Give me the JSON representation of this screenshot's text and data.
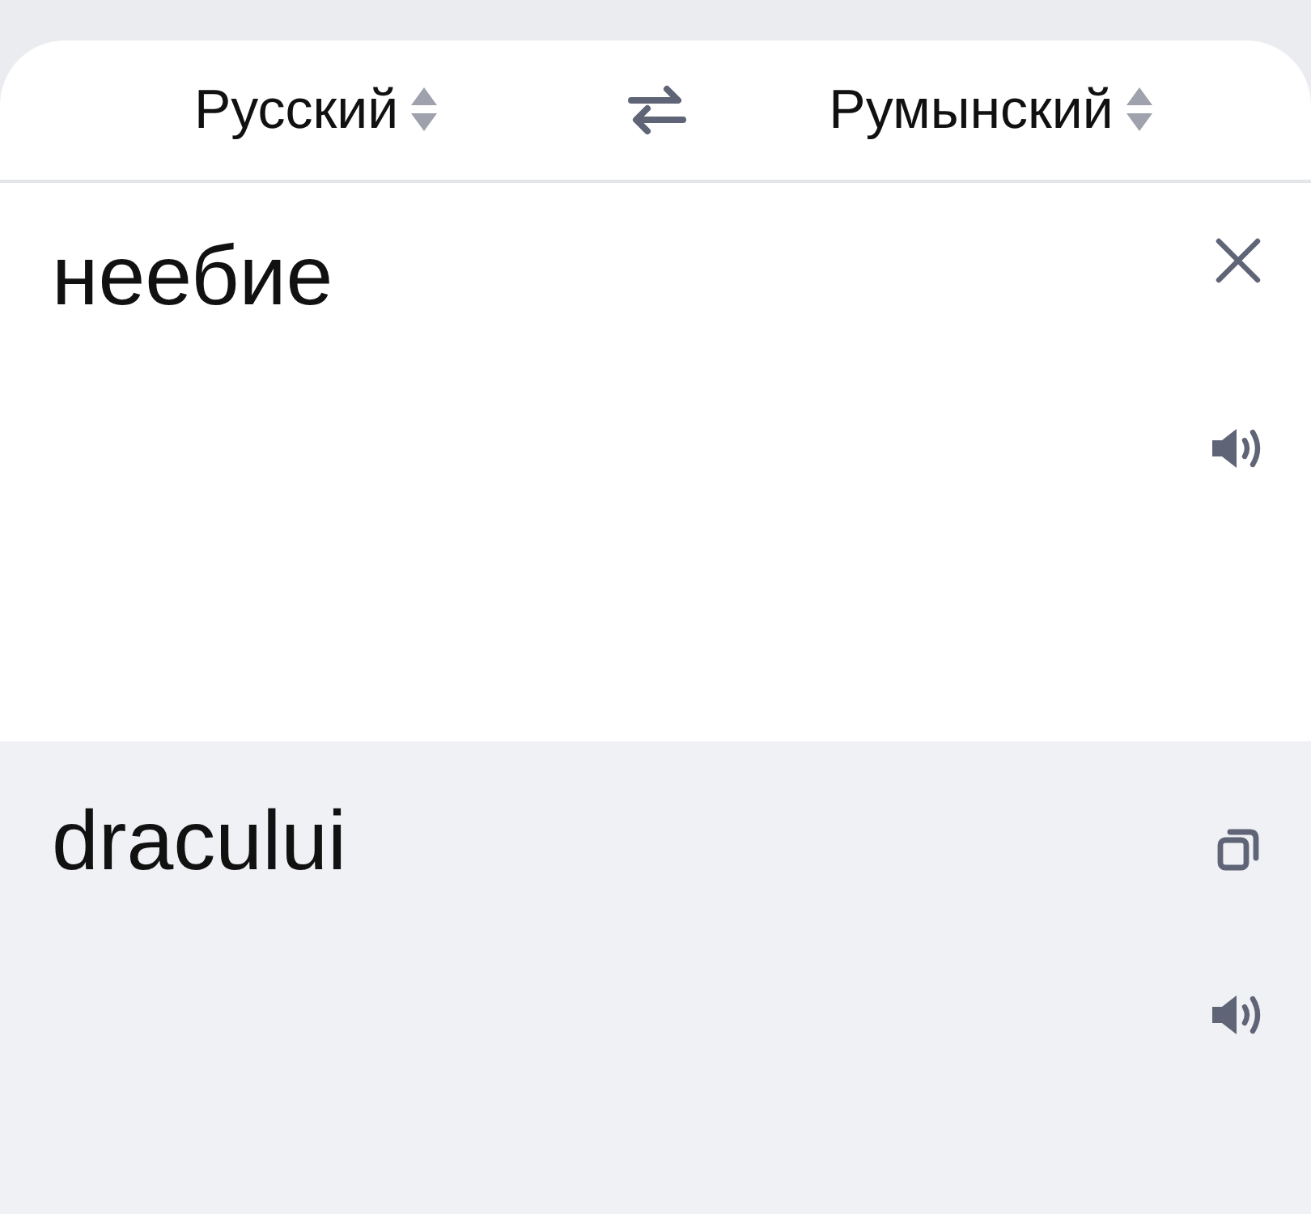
{
  "languages": {
    "source": {
      "label": "Русский"
    },
    "target": {
      "label": "Румынский"
    }
  },
  "input": {
    "value": "неебие"
  },
  "output": {
    "text": "dracului"
  }
}
